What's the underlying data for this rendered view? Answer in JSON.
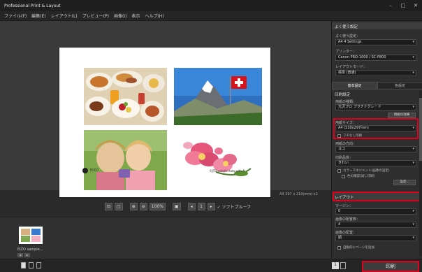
{
  "window": {
    "title": "Professional Print & Layout"
  },
  "menu": [
    "ファイル(F)",
    "編集(E)",
    "レイアウト(L)",
    "プレビュー(P)",
    "画像(I)",
    "表示",
    "ヘルプ(H)"
  ],
  "page": {
    "logo_text": "EIZO",
    "credit_text": "©JTB sample data with AI"
  },
  "status": {
    "text": "A4 297 x 210(mm) x1"
  },
  "toolbar": {
    "zoom_value": "100%",
    "page_value": "1",
    "fit_label": "✓ ソフトプルーフ"
  },
  "filmstrip": {
    "thumb_name": "EIZO sample..."
  },
  "bottom": {
    "page_num": "1",
    "print_label": "印刷"
  },
  "panel": {
    "section1_title": "よく使う設定",
    "preset_label": "よく使う設定：",
    "preset_value": "A4 4 Settings",
    "printer_label": "プリンター：",
    "printer_value": "Canon PRO-1000 / SC-P800",
    "layout_label": "レイアウトモード：",
    "layout_value": "標準 (普通)",
    "tab_basic": "基本設定",
    "tab_detail": "色設定",
    "section2_title": "印刷設定",
    "paper_type_label": "用紙の種類：",
    "paper_type_value": "光沢プロ プラチナグレード",
    "paper_detail_btn": "用紙の詳細",
    "paper_size_label": "用紙サイズ：",
    "paper_size_value": "A4 (210x297mm)",
    "borderless_label": "フチなし印刷",
    "orientation_label": "用紙の方向：",
    "orientation_value": "ヨコ",
    "quality_label": "印刷品質：",
    "quality_value": "きれい",
    "chk1_label": "カラーマネジメント(画像の設定)",
    "chk2_label": "色の確認(試し印刷)",
    "set_btn": "設定...",
    "section3_title": "レイアウト",
    "margin_label": "マージン：",
    "margin_value": "0",
    "count_label": "画像の配置数：",
    "count_value": "4",
    "arrange_label": "画像の配置：",
    "arrange_value": "順",
    "chk3_label": "自動的にページを追加"
  }
}
